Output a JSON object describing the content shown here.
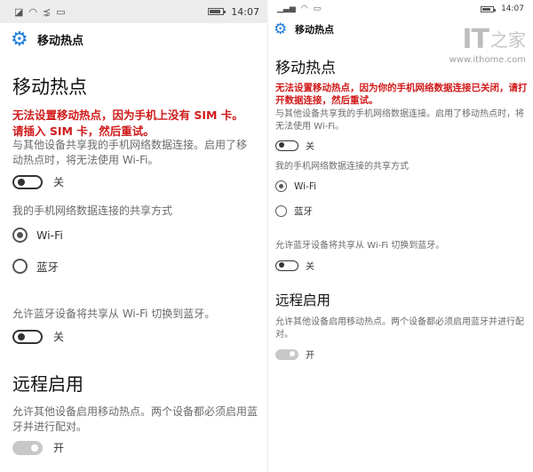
{
  "left": {
    "time": "14:07",
    "header_title": "移动热点",
    "page_title": "移动热点",
    "error": "无法设置移动热点，因为手机上没有 SIM 卡。请插入 SIM 卡，然后重试。",
    "share_desc": "与其他设备共享我的手机网络数据连接。启用了移动热点时，将无法使用 Wi-Fi。",
    "share_toggle": "关",
    "share_mode_label": "我的手机网络数据连接的共享方式",
    "radio_wifi": "Wi-Fi",
    "radio_bt": "蓝牙",
    "bt_switch_desc": "允许蓝牙设备将共享从 Wi-Fi 切换到蓝牙。",
    "bt_switch_toggle": "关",
    "remote_title": "远程启用",
    "remote_desc": "允许其他设备启用移动热点。两个设备都必须启用蓝牙并进行配对。",
    "remote_toggle": "开"
  },
  "right": {
    "time": "14:07",
    "header_title": "移动热点",
    "page_title": "移动热点",
    "error": "无法设置移动热点，因为你的手机网络数据连接已关闭，请打开数据连接，然后重试。",
    "share_desc": "与其他设备共享我的手机网络数据连接。启用了移动热点时，将无法使用 Wi-Fi。",
    "share_toggle": "关",
    "share_mode_label": "我的手机网络数据连接的共享方式",
    "radio_wifi": "Wi-Fi",
    "radio_bt": "蓝牙",
    "bt_switch_desc": "允许蓝牙设备将共享从 Wi-Fi 切换到蓝牙。",
    "bt_switch_toggle": "关",
    "remote_title": "远程启用",
    "remote_desc": "允许其他设备启用移动热点。两个设备都必须启用蓝牙并进行配对。",
    "remote_toggle": "开"
  },
  "watermark": {
    "brand": "IT",
    "brand_char": "之家",
    "url": "www.ithome.com"
  },
  "colors": {
    "accent": "#1e7bd6",
    "error": "#d11a1a"
  },
  "icons": [
    "gear-icon",
    "sim-icon",
    "wifi-signal-icon",
    "message-icon",
    "battery-icon"
  ]
}
